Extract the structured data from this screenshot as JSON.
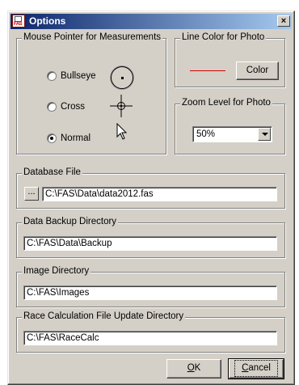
{
  "window": {
    "title": "Options",
    "icon": "fas-app-icon",
    "icon_text": "FAS",
    "close_label": "×"
  },
  "mouse_pointer": {
    "legend": "Mouse Pointer for Measurements",
    "options": [
      {
        "label": "Bullseye",
        "checked": false,
        "icon": "bullseye-icon"
      },
      {
        "label": "Cross",
        "checked": false,
        "icon": "crosshair-icon"
      },
      {
        "label": "Normal",
        "checked": true,
        "icon": "arrow-pointer-icon"
      }
    ]
  },
  "line_color": {
    "legend": "Line Color for Photo",
    "swatch_color": "#d00000",
    "button_label": "Color"
  },
  "zoom": {
    "legend": "Zoom Level for Photo",
    "value": "50%"
  },
  "database_file": {
    "legend": "Database File",
    "browse_label": "...",
    "value": "C:\\FAS\\Data\\data2012.fas"
  },
  "backup_dir": {
    "legend": "Data Backup Directory",
    "value": "C:\\FAS\\Data\\Backup"
  },
  "image_dir": {
    "legend": "Image  Directory",
    "value": "C:\\FAS\\Images"
  },
  "race_dir": {
    "legend": "Race Calculation File Update Directory",
    "value": "C:\\FAS\\RaceCalc"
  },
  "buttons": {
    "ok_mnemonic": "O",
    "ok_rest": "K",
    "cancel_mnemonic": "C",
    "cancel_rest": "ancel"
  },
  "colors": {
    "titlebar_start": "#0a246a",
    "titlebar_end": "#a6caf0",
    "dialog_face": "#d4d0c8"
  }
}
